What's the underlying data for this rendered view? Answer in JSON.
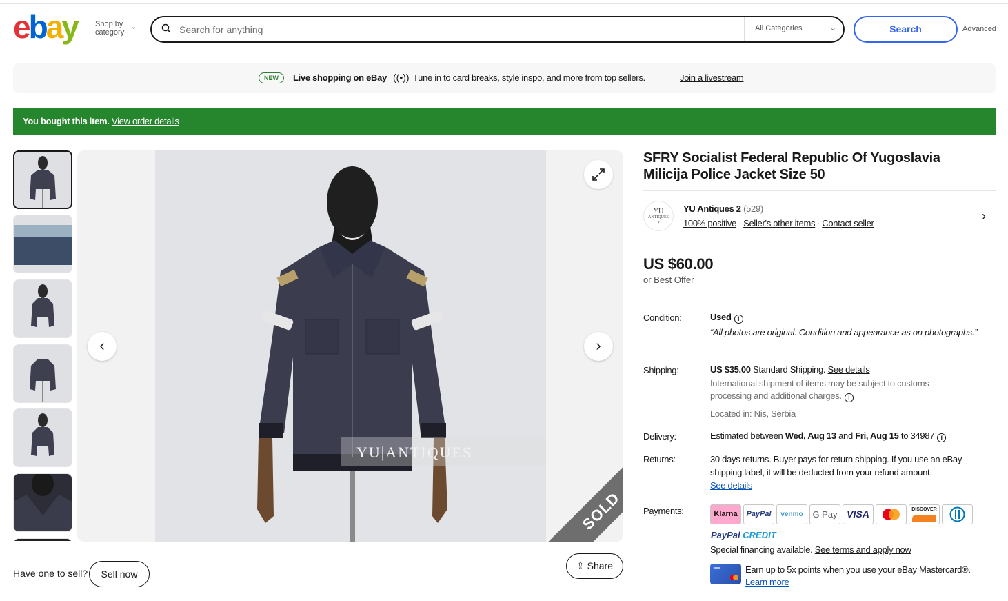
{
  "header": {
    "logo": {
      "e": "e",
      "b": "b",
      "a": "a",
      "y": "y"
    },
    "shop_by_line1": "Shop by",
    "shop_by_line2": "category",
    "search_placeholder": "Search for anything",
    "category": "All Categories",
    "search_button": "Search",
    "advanced": "Advanced"
  },
  "live_banner": {
    "badge": "NEW",
    "title": "Live shopping on eBay",
    "text": "Tune in to card breaks, style inspo, and more from top sellers.",
    "link": "Join a livestream"
  },
  "purchase_banner": {
    "text": "You bought this item.",
    "link": "View order details"
  },
  "gallery": {
    "watermark": "YU|ANTIQUES",
    "sold_label": "SOLD",
    "have_one": "Have one to sell?",
    "sell_now": "Sell now",
    "share": "Share"
  },
  "listing": {
    "title": "SFRY Socialist Federal Republic Of Yugoslavia Milicija Police Jacket Size 50",
    "seller": {
      "avatar_line1": "YU",
      "avatar_line2": "ANTIQUES",
      "avatar_line3": "2",
      "name": "YU Antiques 2",
      "count": "(529)",
      "positive": "100% positive",
      "other_items": "Seller's other items",
      "contact": "Contact seller"
    },
    "price": "US $60.00",
    "best_offer": "or Best Offer",
    "condition_label": "Condition:",
    "condition": "Used",
    "condition_note": "“All photos are original. Condition and appearance as on photographs.”",
    "shipping_label": "Shipping:",
    "shipping_price": "US $35.00",
    "shipping_type": "Standard Shipping.",
    "shipping_details": "See details",
    "shipping_note": "International shipment of items may be subject to customs processing and additional charges.",
    "located": "Located in: Nis, Serbia",
    "delivery_label": "Delivery:",
    "delivery_pre": "Estimated between",
    "delivery_from": "Wed, Aug 13",
    "delivery_and": "and",
    "delivery_to": "Fri, Aug 15",
    "delivery_zip": "to 34987",
    "returns_label": "Returns:",
    "returns_text": "30 days returns. Buyer pays for return shipping. If you use an eBay shipping label, it will be deducted from your refund amount.",
    "returns_details": "See details",
    "payments_label": "Payments:",
    "payment_methods": [
      "Klarna",
      "PayPal",
      "venmo",
      "G Pay",
      "VISA",
      "Mastercard",
      "DISCOVER",
      "Diners"
    ],
    "paypal_credit_a": "PayPal",
    "paypal_credit_b": "CREDIT",
    "financing": "Special financing available.",
    "financing_link": "See terms and apply now",
    "mastercard_text": "Earn up to 5x points when you use your eBay Mastercard®.",
    "learn_more": "Learn more"
  },
  "colors": {
    "accent": "#3665f3",
    "success": "#26862d",
    "sold_band": "#6e6e6e"
  }
}
